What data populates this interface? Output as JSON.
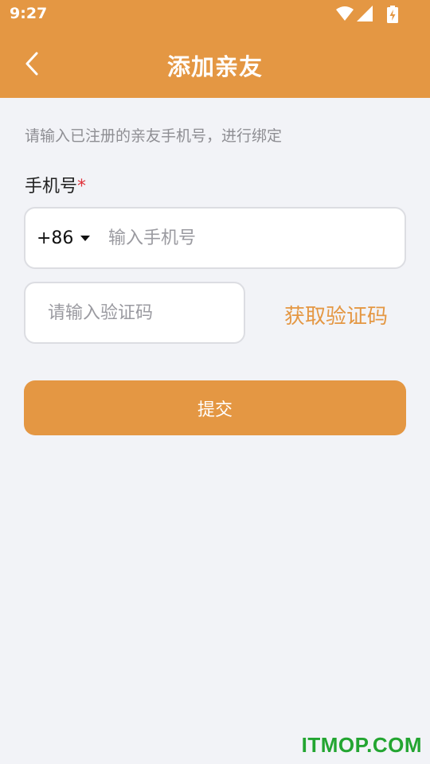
{
  "status_bar": {
    "time": "9:27",
    "icons": [
      "wifi-icon",
      "cellular-signal-icon",
      "battery-charging-icon"
    ]
  },
  "navbar": {
    "title": "添加亲友",
    "back_icon": "chevron-left-icon"
  },
  "form": {
    "hint": "请输入已注册的亲友手机号，进行绑定",
    "phone_label": "手机号",
    "required_mark": "*",
    "country_code": "+86",
    "phone_placeholder": "输入手机号",
    "code_placeholder": "请输入验证码",
    "get_code_label": "获取验证码",
    "submit_label": "提交"
  },
  "watermark": "ITMOP.COM",
  "colors": {
    "primary": "#e49743",
    "background": "#f2f3f7",
    "required": "#e0323a",
    "watermark": "#23a531"
  }
}
